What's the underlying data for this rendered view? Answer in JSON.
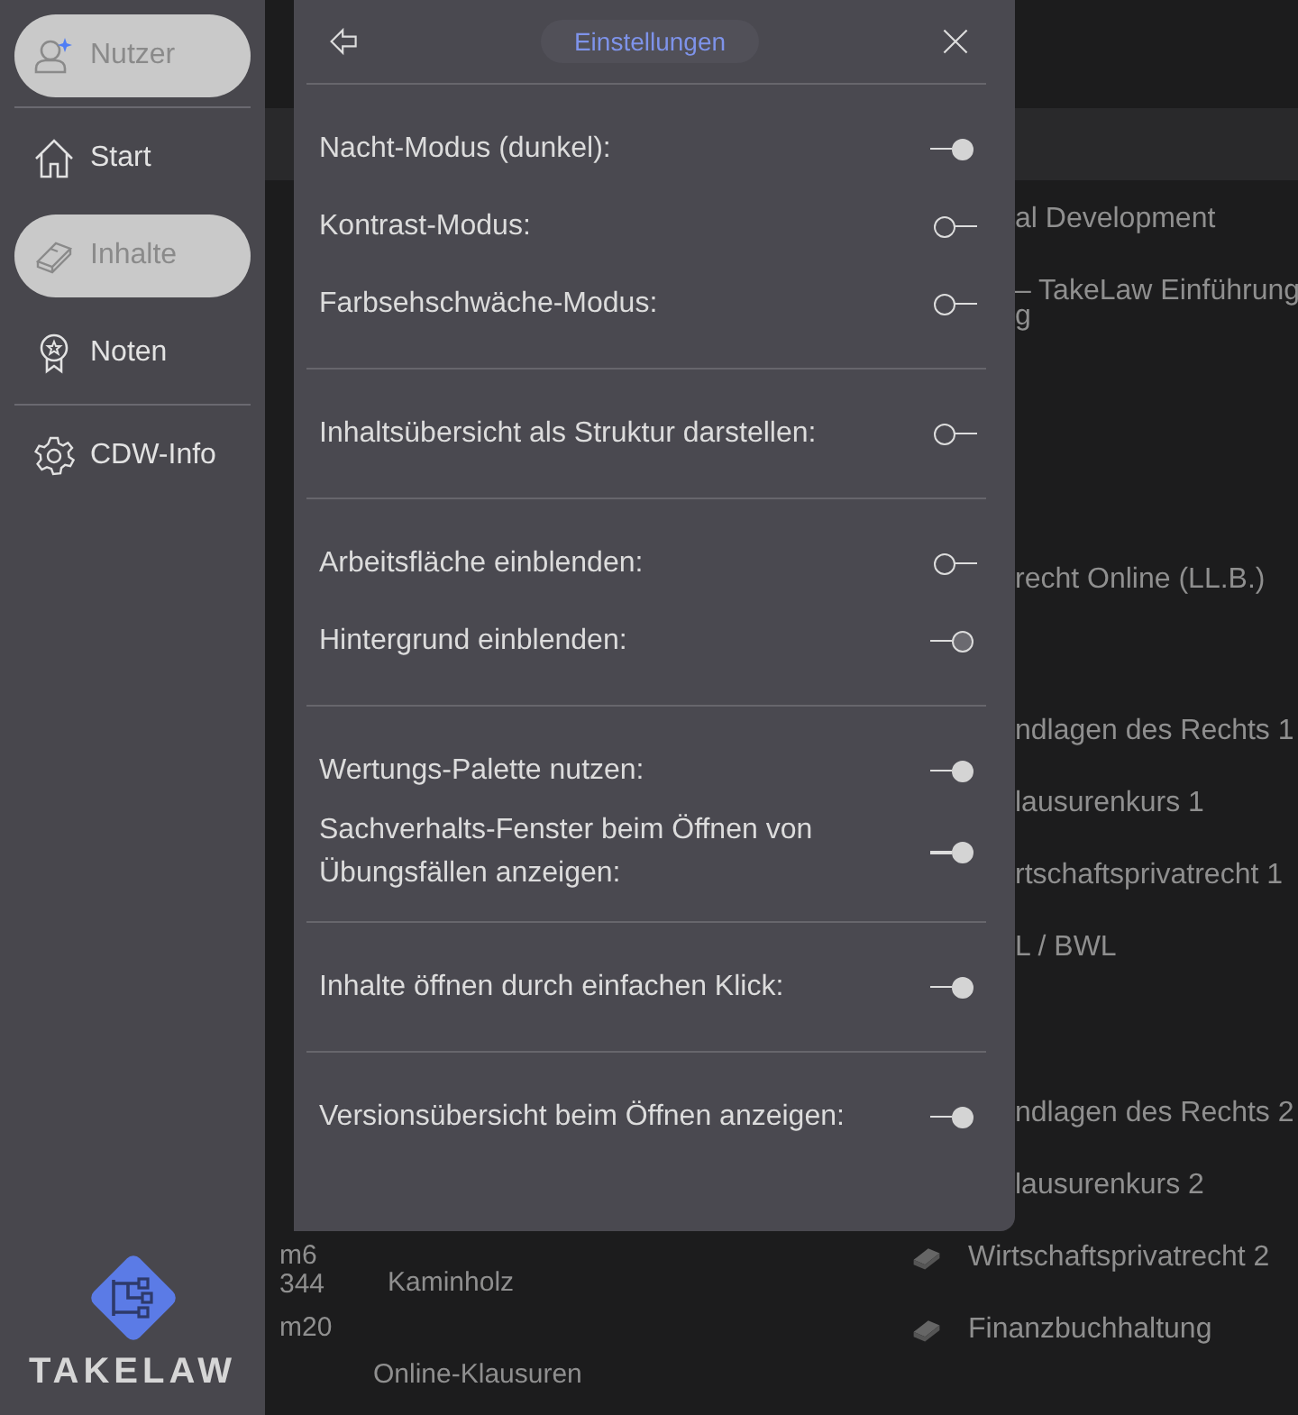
{
  "sidebar": {
    "groups": [
      [
        {
          "label": "Nutzer",
          "kind": "user",
          "selected": true
        }
      ],
      [
        {
          "label": "Start",
          "kind": "home",
          "selected": false
        },
        {
          "label": "Inhalte",
          "kind": "book",
          "selected": true
        },
        {
          "label": "Noten",
          "kind": "award",
          "selected": false
        }
      ],
      [
        {
          "label": "CDW-Info",
          "kind": "gear",
          "selected": false
        }
      ]
    ],
    "brand": {
      "name": "TAKELAW"
    }
  },
  "background": {
    "items": [
      {
        "text": "al Development",
        "kind": "text"
      },
      {
        "text": "– TakeLaw Einführung",
        "kind": "text"
      },
      {
        "text": "g",
        "kind": "text"
      },
      {
        "text": "recht Online (LL.B.)",
        "kind": "text"
      },
      {
        "text": "ndlagen des Rechts 1",
        "kind": "text"
      },
      {
        "text": "lausurenkurs 1",
        "kind": "text"
      },
      {
        "text": "rtschaftsprivatrecht 1",
        "kind": "text"
      },
      {
        "text": "L / BWL",
        "kind": "text"
      },
      {
        "text": "ndlagen des Rechts 2",
        "kind": "text"
      },
      {
        "text": "lausurenkurs 2",
        "kind": "text"
      },
      {
        "text": "Wirtschaftsprivatrecht 2",
        "kind": "book"
      },
      {
        "text": "Finanzbuchhaltung",
        "kind": "book"
      }
    ],
    "lower": [
      "m6",
      "344",
      "Kaminholz",
      "m20",
      "Online-Klausuren"
    ]
  },
  "panel": {
    "title": "Einstellungen",
    "groups": [
      [
        {
          "label": "Nacht-Modus (dunkel):",
          "on": true,
          "kind": "solid"
        },
        {
          "label": "Kontrast-Modus:",
          "on": false,
          "kind": "solid"
        },
        {
          "label": "Farbsehschwäche-Modus:",
          "on": false,
          "kind": "solid"
        }
      ],
      [
        {
          "label": "Inhaltsübersicht als Struktur darstellen:",
          "on": false,
          "kind": "solid"
        }
      ],
      [
        {
          "label": "Arbeitsfläche einblenden:",
          "on": false,
          "kind": "solid"
        },
        {
          "label": "Hintergrund einblenden:",
          "on": true,
          "kind": "outlined"
        }
      ],
      [
        {
          "label": "Wertungs-Palette nutzen:",
          "on": true,
          "kind": "solid"
        },
        {
          "label": "Sachverhalts-Fenster beim Öffnen von Übungsfällen anzeigen:",
          "on": true,
          "kind": "solid"
        }
      ],
      [
        {
          "label": "Inhalte öffnen durch einfachen Klick:",
          "on": true,
          "kind": "solid"
        }
      ],
      [
        {
          "label": "Versionsübersicht beim Öffnen anzeigen:",
          "on": true,
          "kind": "solid"
        }
      ]
    ]
  }
}
